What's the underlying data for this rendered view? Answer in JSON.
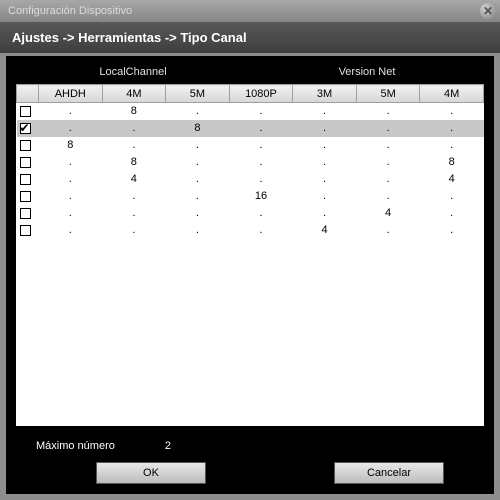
{
  "window": {
    "title": "Configuración Dispositivo"
  },
  "breadcrumb": "Ajustes -> Herramientas -> Tipo Canal",
  "groups": {
    "local": "LocalChannel",
    "net": "Version Net"
  },
  "columns": [
    "AHDH",
    "4M",
    "5M",
    "1080P",
    "3M",
    "5M",
    "4M"
  ],
  "rows": [
    {
      "checked": false,
      "selected": false,
      "cells": [
        ".",
        "8",
        ".",
        ".",
        ".",
        ".",
        "."
      ]
    },
    {
      "checked": true,
      "selected": true,
      "cells": [
        ".",
        ".",
        "8",
        ".",
        ".",
        ".",
        "."
      ]
    },
    {
      "checked": false,
      "selected": false,
      "cells": [
        "8",
        ".",
        ".",
        ".",
        ".",
        ".",
        "."
      ]
    },
    {
      "checked": false,
      "selected": false,
      "cells": [
        ".",
        "8",
        ".",
        ".",
        ".",
        ".",
        "8"
      ]
    },
    {
      "checked": false,
      "selected": false,
      "cells": [
        ".",
        "4",
        ".",
        ".",
        ".",
        ".",
        "4"
      ]
    },
    {
      "checked": false,
      "selected": false,
      "cells": [
        ".",
        ".",
        ".",
        "16",
        ".",
        ".",
        "."
      ]
    },
    {
      "checked": false,
      "selected": false,
      "cells": [
        ".",
        ".",
        ".",
        ".",
        ".",
        "4",
        "."
      ]
    },
    {
      "checked": false,
      "selected": false,
      "cells": [
        ".",
        ".",
        ".",
        ".",
        "4",
        ".",
        "."
      ]
    }
  ],
  "max": {
    "label": "Máximo número",
    "value": "2"
  },
  "buttons": {
    "ok": "OK",
    "cancel": "Cancelar"
  }
}
